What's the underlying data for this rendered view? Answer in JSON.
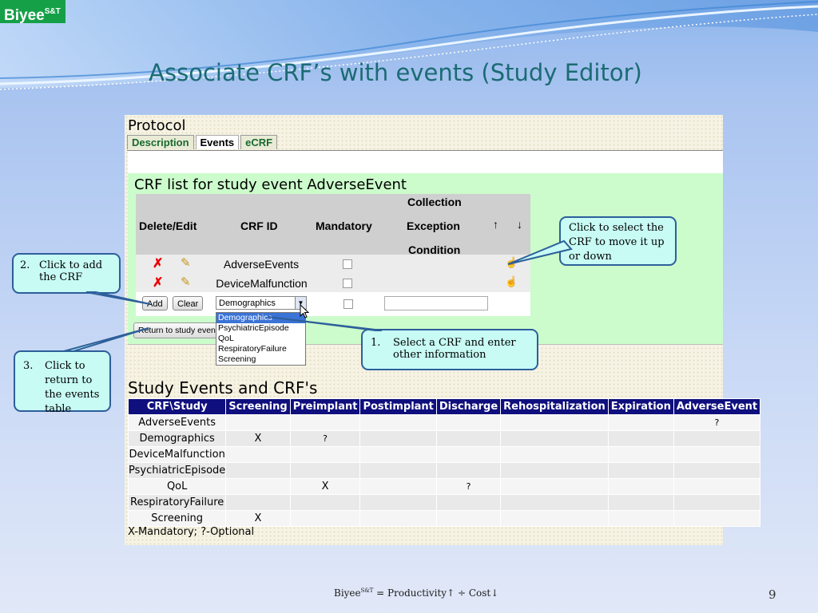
{
  "logo": {
    "text": "Biyee",
    "sup": "S&T"
  },
  "slide_title": "Associate CRF’s with events (Study Editor)",
  "protocol_label": "Protocol",
  "tabs": [
    {
      "label": "Description"
    },
    {
      "label": "Events"
    },
    {
      "label": "eCRF"
    }
  ],
  "crf_section": {
    "title": "CRF list for study event AdverseEvent",
    "headers": {
      "delete_edit": "Delete/Edit",
      "crf_id": "CRF ID",
      "mandatory": "Mandatory",
      "collection": "Collection",
      "exception": "Exception",
      "condition": "Condition"
    },
    "rows": [
      {
        "crf_id": "AdverseEvents"
      },
      {
        "crf_id": "DeviceMalfunction"
      }
    ],
    "add_label": "Add",
    "clear_label": "Clear",
    "select_value": "Demographics",
    "dropdown_options": [
      "Demographics",
      "PsychiatricEpisode",
      "QoL",
      "RespiratoryFailure",
      "Screening"
    ],
    "return_label": "Return to study events"
  },
  "study_section": {
    "title": "Study Events and CRF's",
    "columns": [
      "CRF\\Study",
      "Screening",
      "Preimplant",
      "Postimplant",
      "Discharge",
      "Rehospitalization",
      "Expiration",
      "AdverseEvent"
    ],
    "rows": [
      [
        "AdverseEvents",
        "",
        "",
        "",
        "",
        "",
        "",
        "?"
      ],
      [
        "Demographics",
        "X",
        "?",
        "",
        "",
        "",
        "",
        ""
      ],
      [
        "DeviceMalfunction",
        "",
        "",
        "",
        "",
        "",
        "",
        ""
      ],
      [
        "PsychiatricEpisode",
        "",
        "",
        "",
        "",
        "",
        "",
        ""
      ],
      [
        "QoL",
        "",
        "X",
        "",
        "?",
        "",
        "",
        ""
      ],
      [
        "RespiratoryFailure",
        "",
        "",
        "",
        "",
        "",
        "",
        ""
      ],
      [
        "Screening",
        "X",
        "",
        "",
        "",
        "",
        "",
        ""
      ]
    ],
    "legend": "X-Mandatory;  ?-Optional"
  },
  "callouts": {
    "add": {
      "num": "2.",
      "text": "Click to add the CRF"
    },
    "move": {
      "text": "Click to select the CRF to move it up or down"
    },
    "select": {
      "num": "1.",
      "text": "Select a CRF and enter other information"
    },
    "return": {
      "num": "3.",
      "text": "Click to return to the events  table"
    }
  },
  "footer": {
    "brand": "Biyee",
    "sup": "S&T",
    "formula": " = Productivity",
    "divide": " ÷ Cost",
    "up_arrow": "↑",
    "down_arrow": "↓",
    "page_number": "9"
  },
  "colors": {
    "title": "#1b6b73",
    "logo_bg": "#15a048",
    "header_bg": "#0f0f7e",
    "callout_bg": "#c7fbf4",
    "callout_border": "#2d5f9a",
    "crf_area_bg": "#ccfccc"
  },
  "icons": [
    "delete-icon",
    "edit-icon",
    "move-up-icon",
    "move-down-icon",
    "hand-pointer-icon",
    "cursor-icon"
  ]
}
